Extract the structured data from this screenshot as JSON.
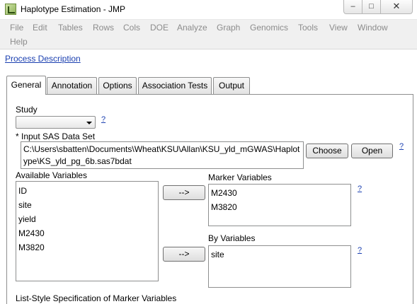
{
  "window": {
    "title": "Haplotype Estimation - JMP",
    "minimize_glyph": "–",
    "maximize_glyph": "□",
    "close_glyph": "✕"
  },
  "menu": {
    "items": [
      "File",
      "Edit",
      "Tables",
      "Rows",
      "Cols",
      "DOE",
      "Analyze",
      "Graph",
      "Genomics",
      "Tools",
      "View",
      "Window"
    ],
    "help": "Help"
  },
  "process_link": "Process Description",
  "tabs": [
    "General",
    "Annotation",
    "Options",
    "Association Tests",
    "Output"
  ],
  "active_tab": "General",
  "form": {
    "study_label": "Study",
    "study_value": "",
    "help_mark": "?",
    "input_label": "* Input SAS Data Set",
    "input_path": "C:\\Users\\sbatten\\Documents\\Wheat\\KSU\\Allan\\KSU_yld_mGWAS\\Haplotype\\KS_yld_pg_6b.sas7bdat",
    "choose_label": "Choose",
    "open_label": "Open",
    "available_label": "Available Variables",
    "available_items": [
      "ID",
      "site",
      "yield",
      "M2430",
      "M3820"
    ],
    "move_button_label": "-->",
    "marker_label": "Marker Variables",
    "marker_items": [
      "M2430",
      "M3820"
    ],
    "by_label": "By Variables",
    "by_items": [
      "site"
    ],
    "list_style_label": "List-Style Specification of Marker Variables"
  }
}
